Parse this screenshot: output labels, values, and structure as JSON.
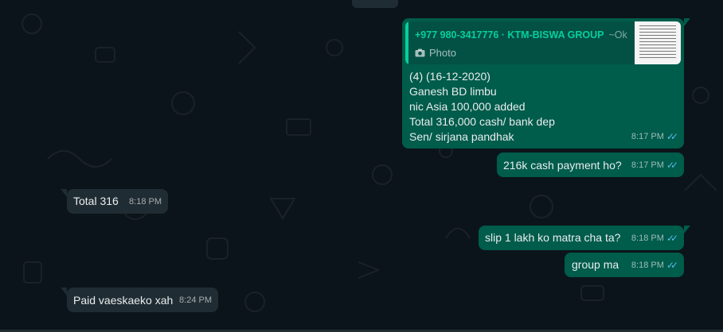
{
  "colors": {
    "background": "#0b141a",
    "incoming_bubble": "#202c33",
    "outgoing_bubble": "#005c4b",
    "quote_accent": "#06cf9c",
    "read_ticks": "#53bdeb"
  },
  "messages": {
    "m1": {
      "quote": {
        "sender": "+977 980-3417776 · KTM-BISWA GROUP",
        "pushname": "~Ok",
        "type_label": "Photo",
        "type_icon": "camera-icon"
      },
      "lines": [
        "(4) (16-12-2020)",
        "Ganesh BD limbu",
        "nic Asia 100,000 added",
        "Total 316,000 cash/ bank dep",
        "Sen/ sirjana pandhak"
      ],
      "time": "8:17 PM",
      "status": "read"
    },
    "m2": {
      "text": "216k cash payment ho?",
      "time": "8:17 PM",
      "status": "read"
    },
    "m3": {
      "text": "Total 316",
      "time": "8:18 PM"
    },
    "m4": {
      "text": "slip 1 lakh ko matra cha ta?",
      "time": "8:18 PM",
      "status": "read"
    },
    "m5": {
      "text": "group ma",
      "time": "8:18 PM",
      "status": "read"
    },
    "m6": {
      "text": "Paid vaeskaeko xah",
      "time": "8:24 PM"
    }
  }
}
